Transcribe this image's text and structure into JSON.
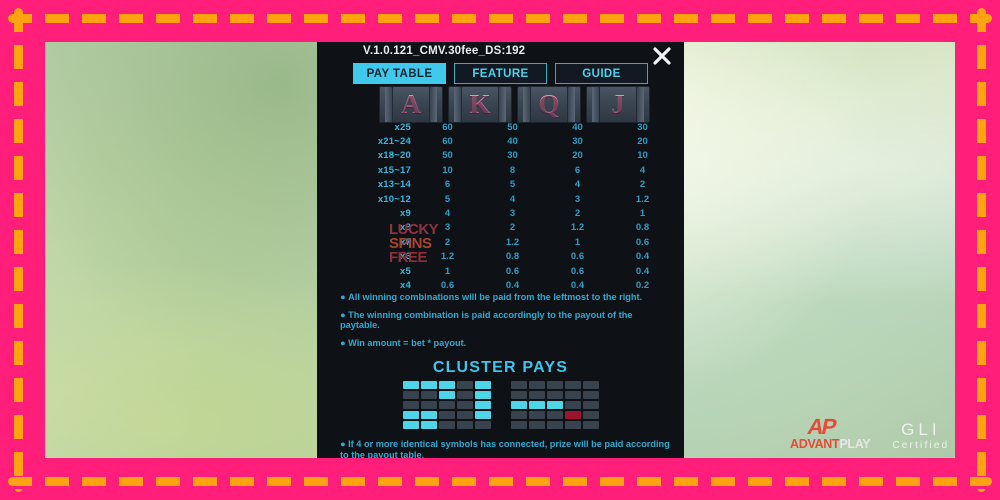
{
  "frame": {
    "border_color": "#ff1f7a",
    "dash_color": "#ffa310"
  },
  "panel": {
    "version": "V.1.0.121_CMV.30fee_DS:192",
    "close_icon": "close-icon",
    "accent_color": "#3fc9ec",
    "background_color": "#0e1116"
  },
  "tabs": [
    {
      "label": "PAY TABLE",
      "active": true
    },
    {
      "label": "FEATURE",
      "active": false
    },
    {
      "label": "GUIDE",
      "active": false
    }
  ],
  "symbols": [
    {
      "letter": "A",
      "name": "symbol-a"
    },
    {
      "letter": "K",
      "name": "symbol-k"
    },
    {
      "letter": "Q",
      "name": "symbol-q"
    },
    {
      "letter": "J",
      "name": "symbol-j"
    }
  ],
  "paytable": {
    "columns": [
      "A",
      "K",
      "Q",
      "J"
    ],
    "rows": [
      {
        "multiplier": "x25",
        "values": [
          "60",
          "50",
          "40",
          "30"
        ]
      },
      {
        "multiplier": "x21~24",
        "values": [
          "60",
          "40",
          "30",
          "20"
        ]
      },
      {
        "multiplier": "x18~20",
        "values": [
          "50",
          "30",
          "20",
          "10"
        ]
      },
      {
        "multiplier": "x15~17",
        "values": [
          "10",
          "8",
          "6",
          "4"
        ]
      },
      {
        "multiplier": "x13~14",
        "values": [
          "6",
          "5",
          "4",
          "2"
        ]
      },
      {
        "multiplier": "x10~12",
        "values": [
          "5",
          "4",
          "3",
          "1.2"
        ]
      },
      {
        "multiplier": "x9",
        "values": [
          "4",
          "3",
          "2",
          "1"
        ]
      },
      {
        "multiplier": "x8",
        "values": [
          "3",
          "2",
          "1.2",
          "0.8"
        ]
      },
      {
        "multiplier": "x7",
        "values": [
          "2",
          "1.2",
          "1",
          "0.6"
        ]
      },
      {
        "multiplier": "x6",
        "values": [
          "1.2",
          "0.8",
          "0.6",
          "0.4"
        ]
      },
      {
        "multiplier": "x5",
        "values": [
          "1",
          "0.6",
          "0.6",
          "0.4"
        ]
      },
      {
        "multiplier": "x4",
        "values": [
          "0.6",
          "0.4",
          "0.4",
          "0.2"
        ]
      }
    ]
  },
  "watermark": {
    "line1": "LUCKY",
    "line2": "SPINS",
    "line3": "FREE"
  },
  "rules": [
    "All winning combinations will be paid from the leftmost to the right.",
    "The winning combination is paid accordingly to the payout of the paytable.",
    "Win amount = bet * payout."
  ],
  "cluster": {
    "title": "CLUSTER PAYS",
    "note": "If 4 or more identical symbols has connected, prize will be paid according to the payout table.",
    "on_color": "#4ed5e8",
    "off_color": "#39434e",
    "red_color": "#9e1430",
    "grid_left": [
      [
        "on",
        "on",
        "on",
        "off",
        "on"
      ],
      [
        "off",
        "off",
        "on",
        "off",
        "on"
      ],
      [
        "off",
        "off",
        "off",
        "off",
        "on"
      ],
      [
        "on",
        "on",
        "off",
        "off",
        "on"
      ],
      [
        "on",
        "on",
        "off",
        "off",
        "off"
      ]
    ],
    "grid_right": [
      [
        "off",
        "off",
        "off",
        "off",
        "off"
      ],
      [
        "off",
        "off",
        "off",
        "off",
        "off"
      ],
      [
        "on",
        "on",
        "on",
        "off",
        "off"
      ],
      [
        "off",
        "off",
        "off",
        "red",
        "off"
      ],
      [
        "off",
        "off",
        "off",
        "off",
        "off"
      ]
    ]
  },
  "logos": {
    "advantplay_mark": "AP",
    "advantplay_a": "ADVANT",
    "advantplay_b": "PLAY",
    "gli_main": "GLI",
    "gli_sub": "Certified"
  }
}
